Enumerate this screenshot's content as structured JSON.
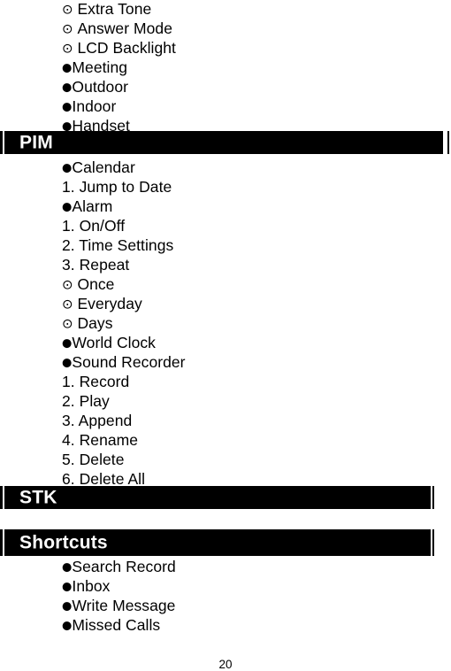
{
  "document": {
    "page_number": "20",
    "glyphs": {
      "ring_bullet": "⊙",
      "solid_bullet": "●"
    }
  },
  "sections": [
    {
      "id": "profiles-continued",
      "header": null,
      "items": [
        {
          "marker": "ring",
          "text": "Extra Tone"
        },
        {
          "marker": "ring",
          "text": "Answer Mode"
        },
        {
          "marker": "ring",
          "text": "LCD Backlight"
        },
        {
          "marker": "solid",
          "text": "Meeting"
        },
        {
          "marker": "solid",
          "text": "Outdoor"
        },
        {
          "marker": "solid",
          "text": "Indoor"
        },
        {
          "marker": "solid",
          "text": "Handset"
        }
      ]
    },
    {
      "id": "pim",
      "header": "PIM",
      "items": [
        {
          "marker": "solid",
          "text": "Calendar"
        },
        {
          "marker": "none",
          "text": "1. Jump to Date"
        },
        {
          "marker": "solid",
          "text": "Alarm"
        },
        {
          "marker": "none",
          "text": "1. On/Off"
        },
        {
          "marker": "none",
          "text": "2. Time Settings"
        },
        {
          "marker": "none",
          "text": "3. Repeat"
        },
        {
          "marker": "ring",
          "text": "Once"
        },
        {
          "marker": "ring",
          "text": "Everyday"
        },
        {
          "marker": "ring",
          "text": "Days"
        },
        {
          "marker": "solid",
          "text": "World Clock"
        },
        {
          "marker": "solid",
          "text": "Sound Recorder"
        },
        {
          "marker": "none",
          "text": "1. Record"
        },
        {
          "marker": "none",
          "text": "2. Play"
        },
        {
          "marker": "none",
          "text": "3. Append"
        },
        {
          "marker": "none",
          "text": "4. Rename"
        },
        {
          "marker": "none",
          "text": "5. Delete"
        },
        {
          "marker": "none",
          "text": "6. Delete All"
        }
      ]
    },
    {
      "id": "stk",
      "header": "STK",
      "items": []
    },
    {
      "id": "shortcuts",
      "header": "Shortcuts",
      "items": [
        {
          "marker": "solid",
          "text": "Search Record"
        },
        {
          "marker": "solid",
          "text": "Inbox"
        },
        {
          "marker": "solid",
          "text": "Write Message"
        },
        {
          "marker": "solid",
          "text": "Missed Calls"
        }
      ]
    }
  ]
}
